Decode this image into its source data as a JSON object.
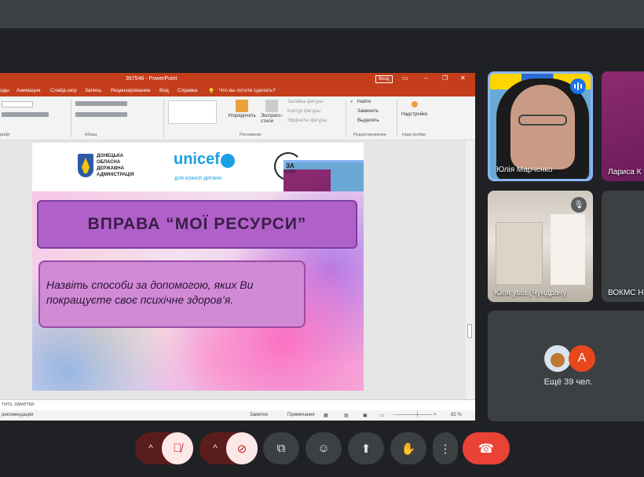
{
  "powerpoint": {
    "doc_title": "397546 - PowerPoint",
    "signin": "Вход",
    "menu": [
      "оды",
      "Анимация",
      "Слайд-шоу",
      "Запись",
      "Рецензирование",
      "Вид",
      "Справка",
      "Что вы хотите сделать?"
    ],
    "ribbon": {
      "groups": [
        "рифт",
        "Абзац",
        "Рисование",
        "Редактирование",
        "Надстройки"
      ],
      "arrange": "Упорядочить",
      "quick_styles": "Экспресс-стили",
      "shape_fill": "Заливка фигуры",
      "shape_outline": "Контур фигуры",
      "shape_effects": "Эффекты фигуры",
      "find": "Найти",
      "replace": "Заменить",
      "select": "Выделить",
      "addins": "Надстройки"
    },
    "slide": {
      "admin_text": "ДОНЕЦЬКА ОБЛАСНА ДЕРЖАВНА АДМІНІСТРАЦІЯ",
      "unicef": "unicef",
      "unicef_sub": "для кожної дитини",
      "za_logo_1": "ЗА",
      "za_logo_2": "ХОДИ",
      "title": "ВПРАВА “МОЇ РЕСУРСИ”",
      "body": "Назвіть способи за допомогою, яких Ви покращуєте своє психічне здоров’я."
    },
    "notes_placeholder": "тить заметки",
    "status": {
      "left": "рекомендации",
      "notes": "Заметки",
      "comments": "Примечания",
      "zoom": "82 %"
    }
  },
  "participants": [
    {
      "name": "Юлія Марченко",
      "speaking": true
    },
    {
      "name": "Лариса К"
    },
    {
      "name": "Юля yula (Чундрачу",
      "muted": true
    },
    {
      "name": "ВОКМС Н"
    }
  ],
  "others": {
    "avatar_letter": "А",
    "count_label": "Ещё 39 чел."
  },
  "controls": {
    "caret": "^",
    "mic_off": "mic-off-icon",
    "cam_off": "camera-off-icon",
    "cc": "captions-icon",
    "emoji": "emoji-icon",
    "present": "present-icon",
    "hand": "raise-hand-icon",
    "more": "more-icon",
    "end_call": "end-call-icon"
  }
}
